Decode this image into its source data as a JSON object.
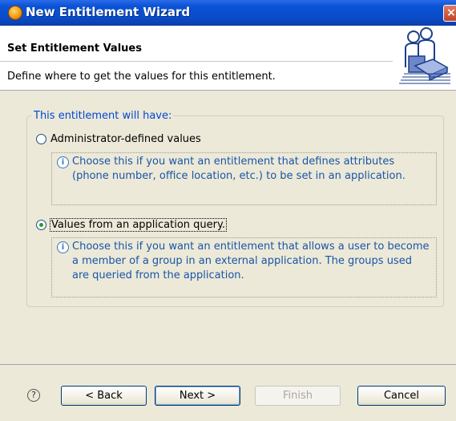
{
  "window": {
    "title": "New Entitlement Wizard",
    "close": "×"
  },
  "header": {
    "title": "Set Entitlement Values",
    "description": "Define where to get the values for this entitlement."
  },
  "group": {
    "legend": "This entitlement will have:",
    "options": [
      {
        "label": "Administrator-defined values",
        "checked": false,
        "info": "Choose this if you want an entitlement that defines attributes (phone number, office location, etc.) to be set in an application."
      },
      {
        "label": "Values from an application query.",
        "checked": true,
        "info": "Choose this if you want an entitlement that allows a user to become a member of a group in an external application. The groups used are queried from the application."
      }
    ]
  },
  "buttons": {
    "help": "?",
    "back": "< Back",
    "next": "Next >",
    "finish": "Finish",
    "cancel": "Cancel"
  },
  "icons": {
    "info": "i"
  }
}
